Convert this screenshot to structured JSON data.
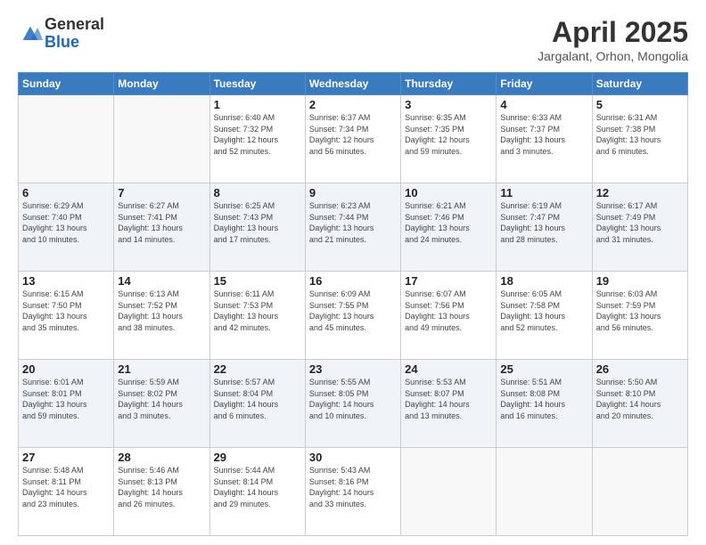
{
  "logo": {
    "general": "General",
    "blue": "Blue"
  },
  "header": {
    "month": "April 2025",
    "location": "Jargalant, Orhon, Mongolia"
  },
  "days": [
    "Sunday",
    "Monday",
    "Tuesday",
    "Wednesday",
    "Thursday",
    "Friday",
    "Saturday"
  ],
  "weeks": [
    [
      {
        "day": "",
        "info": ""
      },
      {
        "day": "",
        "info": ""
      },
      {
        "day": "1",
        "info": "Sunrise: 6:40 AM\nSunset: 7:32 PM\nDaylight: 12 hours\nand 52 minutes."
      },
      {
        "day": "2",
        "info": "Sunrise: 6:37 AM\nSunset: 7:34 PM\nDaylight: 12 hours\nand 56 minutes."
      },
      {
        "day": "3",
        "info": "Sunrise: 6:35 AM\nSunset: 7:35 PM\nDaylight: 12 hours\nand 59 minutes."
      },
      {
        "day": "4",
        "info": "Sunrise: 6:33 AM\nSunset: 7:37 PM\nDaylight: 13 hours\nand 3 minutes."
      },
      {
        "day": "5",
        "info": "Sunrise: 6:31 AM\nSunset: 7:38 PM\nDaylight: 13 hours\nand 6 minutes."
      }
    ],
    [
      {
        "day": "6",
        "info": "Sunrise: 6:29 AM\nSunset: 7:40 PM\nDaylight: 13 hours\nand 10 minutes."
      },
      {
        "day": "7",
        "info": "Sunrise: 6:27 AM\nSunset: 7:41 PM\nDaylight: 13 hours\nand 14 minutes."
      },
      {
        "day": "8",
        "info": "Sunrise: 6:25 AM\nSunset: 7:43 PM\nDaylight: 13 hours\nand 17 minutes."
      },
      {
        "day": "9",
        "info": "Sunrise: 6:23 AM\nSunset: 7:44 PM\nDaylight: 13 hours\nand 21 minutes."
      },
      {
        "day": "10",
        "info": "Sunrise: 6:21 AM\nSunset: 7:46 PM\nDaylight: 13 hours\nand 24 minutes."
      },
      {
        "day": "11",
        "info": "Sunrise: 6:19 AM\nSunset: 7:47 PM\nDaylight: 13 hours\nand 28 minutes."
      },
      {
        "day": "12",
        "info": "Sunrise: 6:17 AM\nSunset: 7:49 PM\nDaylight: 13 hours\nand 31 minutes."
      }
    ],
    [
      {
        "day": "13",
        "info": "Sunrise: 6:15 AM\nSunset: 7:50 PM\nDaylight: 13 hours\nand 35 minutes."
      },
      {
        "day": "14",
        "info": "Sunrise: 6:13 AM\nSunset: 7:52 PM\nDaylight: 13 hours\nand 38 minutes."
      },
      {
        "day": "15",
        "info": "Sunrise: 6:11 AM\nSunset: 7:53 PM\nDaylight: 13 hours\nand 42 minutes."
      },
      {
        "day": "16",
        "info": "Sunrise: 6:09 AM\nSunset: 7:55 PM\nDaylight: 13 hours\nand 45 minutes."
      },
      {
        "day": "17",
        "info": "Sunrise: 6:07 AM\nSunset: 7:56 PM\nDaylight: 13 hours\nand 49 minutes."
      },
      {
        "day": "18",
        "info": "Sunrise: 6:05 AM\nSunset: 7:58 PM\nDaylight: 13 hours\nand 52 minutes."
      },
      {
        "day": "19",
        "info": "Sunrise: 6:03 AM\nSunset: 7:59 PM\nDaylight: 13 hours\nand 56 minutes."
      }
    ],
    [
      {
        "day": "20",
        "info": "Sunrise: 6:01 AM\nSunset: 8:01 PM\nDaylight: 13 hours\nand 59 minutes."
      },
      {
        "day": "21",
        "info": "Sunrise: 5:59 AM\nSunset: 8:02 PM\nDaylight: 14 hours\nand 3 minutes."
      },
      {
        "day": "22",
        "info": "Sunrise: 5:57 AM\nSunset: 8:04 PM\nDaylight: 14 hours\nand 6 minutes."
      },
      {
        "day": "23",
        "info": "Sunrise: 5:55 AM\nSunset: 8:05 PM\nDaylight: 14 hours\nand 10 minutes."
      },
      {
        "day": "24",
        "info": "Sunrise: 5:53 AM\nSunset: 8:07 PM\nDaylight: 14 hours\nand 13 minutes."
      },
      {
        "day": "25",
        "info": "Sunrise: 5:51 AM\nSunset: 8:08 PM\nDaylight: 14 hours\nand 16 minutes."
      },
      {
        "day": "26",
        "info": "Sunrise: 5:50 AM\nSunset: 8:10 PM\nDaylight: 14 hours\nand 20 minutes."
      }
    ],
    [
      {
        "day": "27",
        "info": "Sunrise: 5:48 AM\nSunset: 8:11 PM\nDaylight: 14 hours\nand 23 minutes."
      },
      {
        "day": "28",
        "info": "Sunrise: 5:46 AM\nSunset: 8:13 PM\nDaylight: 14 hours\nand 26 minutes."
      },
      {
        "day": "29",
        "info": "Sunrise: 5:44 AM\nSunset: 8:14 PM\nDaylight: 14 hours\nand 29 minutes."
      },
      {
        "day": "30",
        "info": "Sunrise: 5:43 AM\nSunset: 8:16 PM\nDaylight: 14 hours\nand 33 minutes."
      },
      {
        "day": "",
        "info": ""
      },
      {
        "day": "",
        "info": ""
      },
      {
        "day": "",
        "info": ""
      }
    ]
  ]
}
